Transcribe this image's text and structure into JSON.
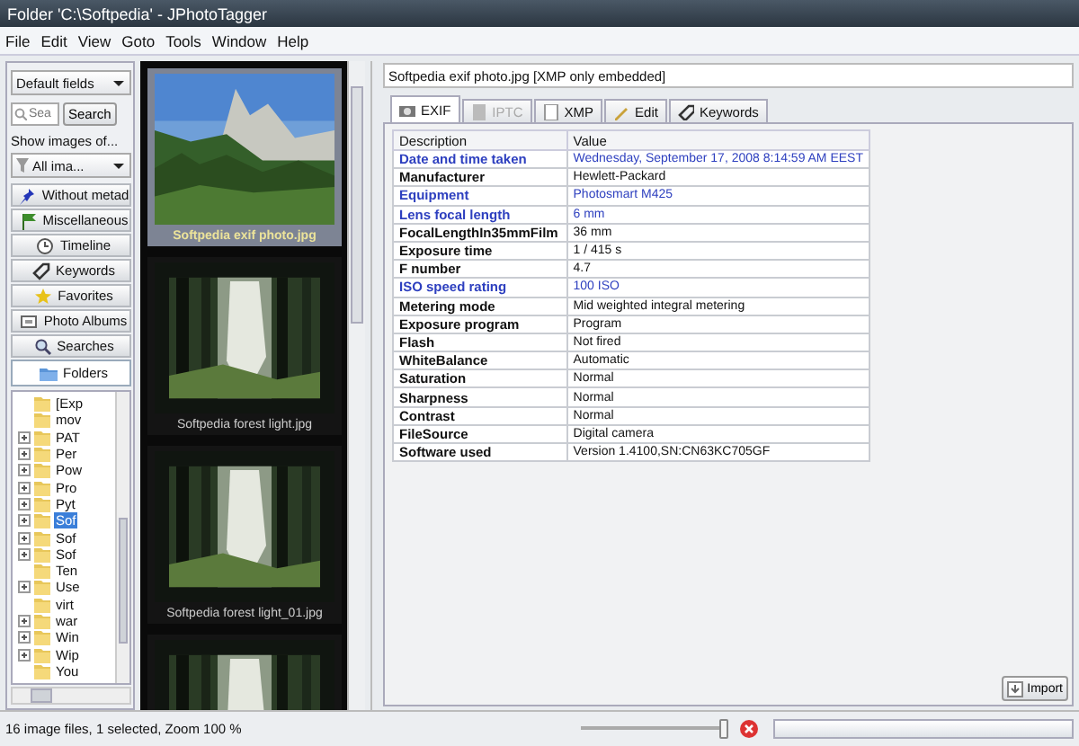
{
  "window": {
    "title": "Folder 'C:\\Softpedia' - JPhotoTagger"
  },
  "menu": [
    "File",
    "Edit",
    "View",
    "Goto",
    "Tools",
    "Window",
    "Help"
  ],
  "sidebar": {
    "fields_combo": "Default fields",
    "search": {
      "placeholder": "Sea"
    },
    "search_button": "Search",
    "show_label": "Show images of...",
    "filter_combo": "All ima...",
    "sections": [
      {
        "label": "Without metad",
        "selected": false
      },
      {
        "label": "Miscellaneous",
        "selected": false
      },
      {
        "label": "Timeline",
        "selected": false
      },
      {
        "label": "Keywords",
        "selected": false
      },
      {
        "label": "Favorites",
        "selected": false
      },
      {
        "label": "Photo Albums",
        "selected": false
      },
      {
        "label": "Searches",
        "selected": false
      },
      {
        "label": "Folders",
        "selected": true
      }
    ],
    "tree": [
      {
        "label": "[Exp",
        "expandable": false,
        "selected": false
      },
      {
        "label": "mov",
        "expandable": false,
        "selected": false
      },
      {
        "label": "PAT",
        "expandable": true,
        "selected": false
      },
      {
        "label": "Per",
        "expandable": true,
        "selected": false
      },
      {
        "label": "Pow",
        "expandable": true,
        "selected": false
      },
      {
        "label": "Pro",
        "expandable": true,
        "selected": false
      },
      {
        "label": "Pyt",
        "expandable": true,
        "selected": false
      },
      {
        "label": "Sof",
        "expandable": true,
        "selected": true
      },
      {
        "label": "Sof",
        "expandable": true,
        "selected": false
      },
      {
        "label": "Sof",
        "expandable": true,
        "selected": false
      },
      {
        "label": "Ten",
        "expandable": false,
        "selected": false
      },
      {
        "label": "Use",
        "expandable": true,
        "selected": false
      },
      {
        "label": "virt",
        "expandable": false,
        "selected": false
      },
      {
        "label": "war",
        "expandable": true,
        "selected": false
      },
      {
        "label": "Win",
        "expandable": true,
        "selected": false
      },
      {
        "label": "Wip",
        "expandable": true,
        "selected": false
      },
      {
        "label": "You",
        "expandable": false,
        "selected": false
      }
    ]
  },
  "thumbnails": [
    {
      "caption": "Softpedia exif photo.jpg",
      "selected": true
    },
    {
      "caption": "Softpedia forest light.jpg",
      "selected": false
    },
    {
      "caption": "Softpedia forest light_01.jpg",
      "selected": false
    },
    {
      "selected": false
    }
  ],
  "detail": {
    "file": "Softpedia exif photo.jpg [XMP only embedded]",
    "tabs": [
      {
        "label": "EXIF",
        "selected": true,
        "disabled": false
      },
      {
        "label": "IPTC",
        "selected": false,
        "disabled": true
      },
      {
        "label": "XMP",
        "selected": false,
        "disabled": false
      },
      {
        "label": "Edit",
        "selected": false,
        "disabled": false
      },
      {
        "label": "Keywords",
        "selected": false,
        "disabled": false
      }
    ],
    "table": {
      "columns": [
        "Description",
        "Value"
      ],
      "rows": [
        {
          "name": "Date and time taken",
          "value": "Wednesday, September 17, 2008 8:14:59 AM EEST",
          "highlighted": true
        },
        {
          "name": "Manufacturer",
          "value": "Hewlett-Packard",
          "highlighted": false
        },
        {
          "name": "Equipment",
          "value": "Photosmart M425",
          "highlighted": true
        },
        {
          "name": "Lens focal length",
          "value": "6 mm",
          "highlighted": true
        },
        {
          "name": "FocalLengthIn35mmFilm",
          "value": "36 mm",
          "highlighted": false
        },
        {
          "name": "Exposure time",
          "value": "1 / 415 s",
          "highlighted": false
        },
        {
          "name": "F number",
          "value": "4.7",
          "highlighted": false
        },
        {
          "name": "ISO speed rating",
          "value": "100 ISO",
          "highlighted": true
        },
        {
          "name": "Metering mode",
          "value": "Mid weighted integral metering",
          "highlighted": false
        },
        {
          "name": "Exposure program",
          "value": "Program",
          "highlighted": false
        },
        {
          "name": "Flash",
          "value": "Not fired",
          "highlighted": false
        },
        {
          "name": "WhiteBalance",
          "value": "Automatic",
          "highlighted": false
        },
        {
          "name": "Saturation",
          "value": "Normal",
          "highlighted": false
        },
        {
          "name": "Sharpness",
          "value": "Normal",
          "highlighted": false
        },
        {
          "name": "Contrast",
          "value": "Normal",
          "highlighted": false
        },
        {
          "name": "FileSource",
          "value": "Digital camera",
          "highlighted": false
        },
        {
          "name": "Software used",
          "value": "Version 1.4100,SN:CN63KC705GF",
          "highlighted": false
        }
      ]
    },
    "import_button": "Import"
  },
  "status_bar": {
    "text": "16 image files, 1 selected, Zoom 100 %",
    "zoom_slider": {
      "level": 1
    },
    "progress": {
      "level": 0
    }
  }
}
